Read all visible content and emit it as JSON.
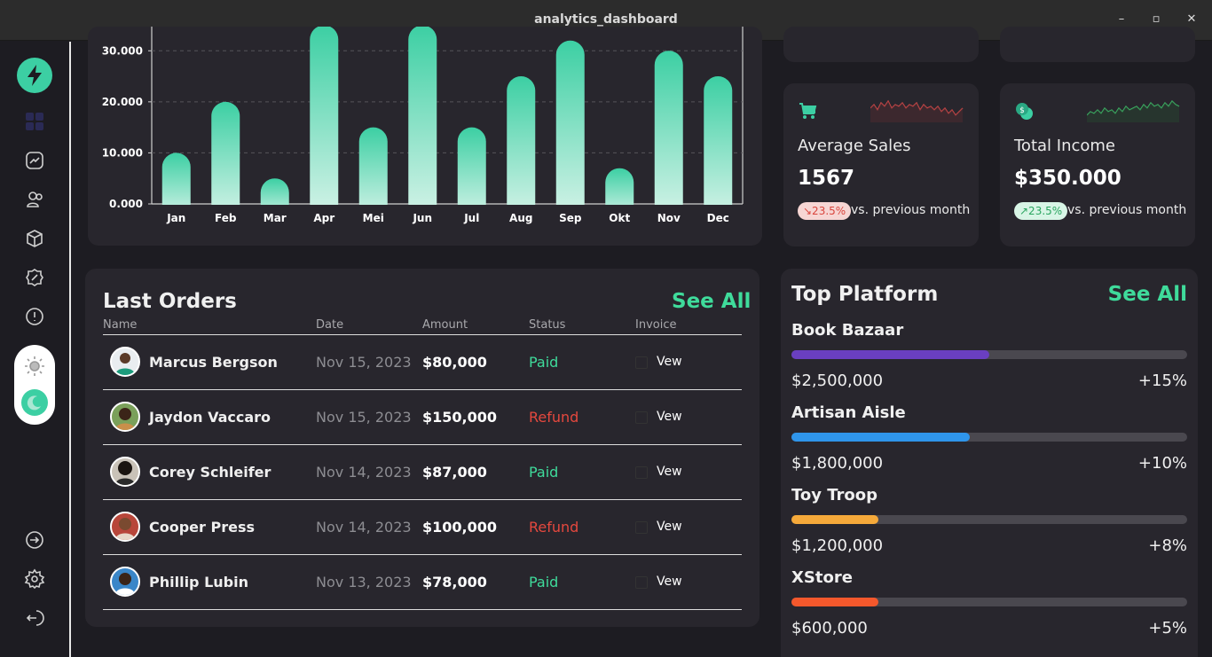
{
  "window": {
    "title": "analytics_dashboard",
    "minimize": "–",
    "maximize": "▫",
    "close": "✕"
  },
  "chart_data": {
    "type": "bar",
    "categories": [
      "Jan",
      "Feb",
      "Mar",
      "Apr",
      "Mei",
      "Jun",
      "Jul",
      "Aug",
      "Sep",
      "Okt",
      "Nov",
      "Dec"
    ],
    "values": [
      10000,
      20000,
      5000,
      35000,
      15000,
      35000,
      15000,
      25000,
      32000,
      7000,
      30000,
      25000
    ],
    "y_ticks": [
      "0.000",
      "10.000",
      "20.000",
      "30.000"
    ],
    "ylim": [
      0,
      33000
    ],
    "grid": true,
    "colors": {
      "top": "#3ccfa3",
      "bottom": "#d4f3e8"
    }
  },
  "stats": [
    {
      "title": "Average Sales",
      "value": "1567",
      "change": "↘23.5%",
      "trend": "down",
      "vs": "vs. previous month"
    },
    {
      "title": "Total Income",
      "value": "$350.000",
      "change": "↗23.5%",
      "trend": "up",
      "vs": "vs. previous month"
    }
  ],
  "orders": {
    "title": "Last Orders",
    "see_all": "See All",
    "headers": {
      "name": "Name",
      "date": "Date",
      "amount": "Amount",
      "status": "Status",
      "invoice": "Invoice"
    },
    "rows": [
      {
        "name": "Marcus Bergson",
        "date": "Nov 15, 2023",
        "amount": "$80,000",
        "status": "Paid",
        "invoice": "Vew"
      },
      {
        "name": "Jaydon Vaccaro",
        "date": "Nov 15, 2023",
        "amount": "$150,000",
        "status": "Refund",
        "invoice": "Vew"
      },
      {
        "name": "Corey Schleifer",
        "date": "Nov 14, 2023",
        "amount": "$87,000",
        "status": "Paid",
        "invoice": "Vew"
      },
      {
        "name": "Cooper Press",
        "date": "Nov 14, 2023",
        "amount": "$100,000",
        "status": "Refund",
        "invoice": "Vew"
      },
      {
        "name": "Phillip Lubin",
        "date": "Nov 13, 2023",
        "amount": "$78,000",
        "status": "Paid",
        "invoice": "Vew"
      }
    ]
  },
  "platforms": {
    "title": "Top Platform",
    "see_all": "See All",
    "items": [
      {
        "name": "Book Bazaar",
        "value": "$2,500,000",
        "pct": "+15%",
        "fill": 0.5,
        "color": "#6a3fc0"
      },
      {
        "name": "Artisan Aisle",
        "value": "$1,800,000",
        "pct": "+10%",
        "fill": 0.45,
        "color": "#2f95ea"
      },
      {
        "name": "Toy Troop",
        "value": "$1,200,000",
        "pct": "+8%",
        "fill": 0.22,
        "color": "#f5a93a"
      },
      {
        "name": "XStore",
        "value": "$600,000",
        "pct": "+5%",
        "fill": 0.22,
        "color": "#f4582c"
      }
    ]
  },
  "colors": {
    "accent": "#3fdb9b",
    "paid": "#3fdb9b",
    "refund": "#e5483e"
  }
}
